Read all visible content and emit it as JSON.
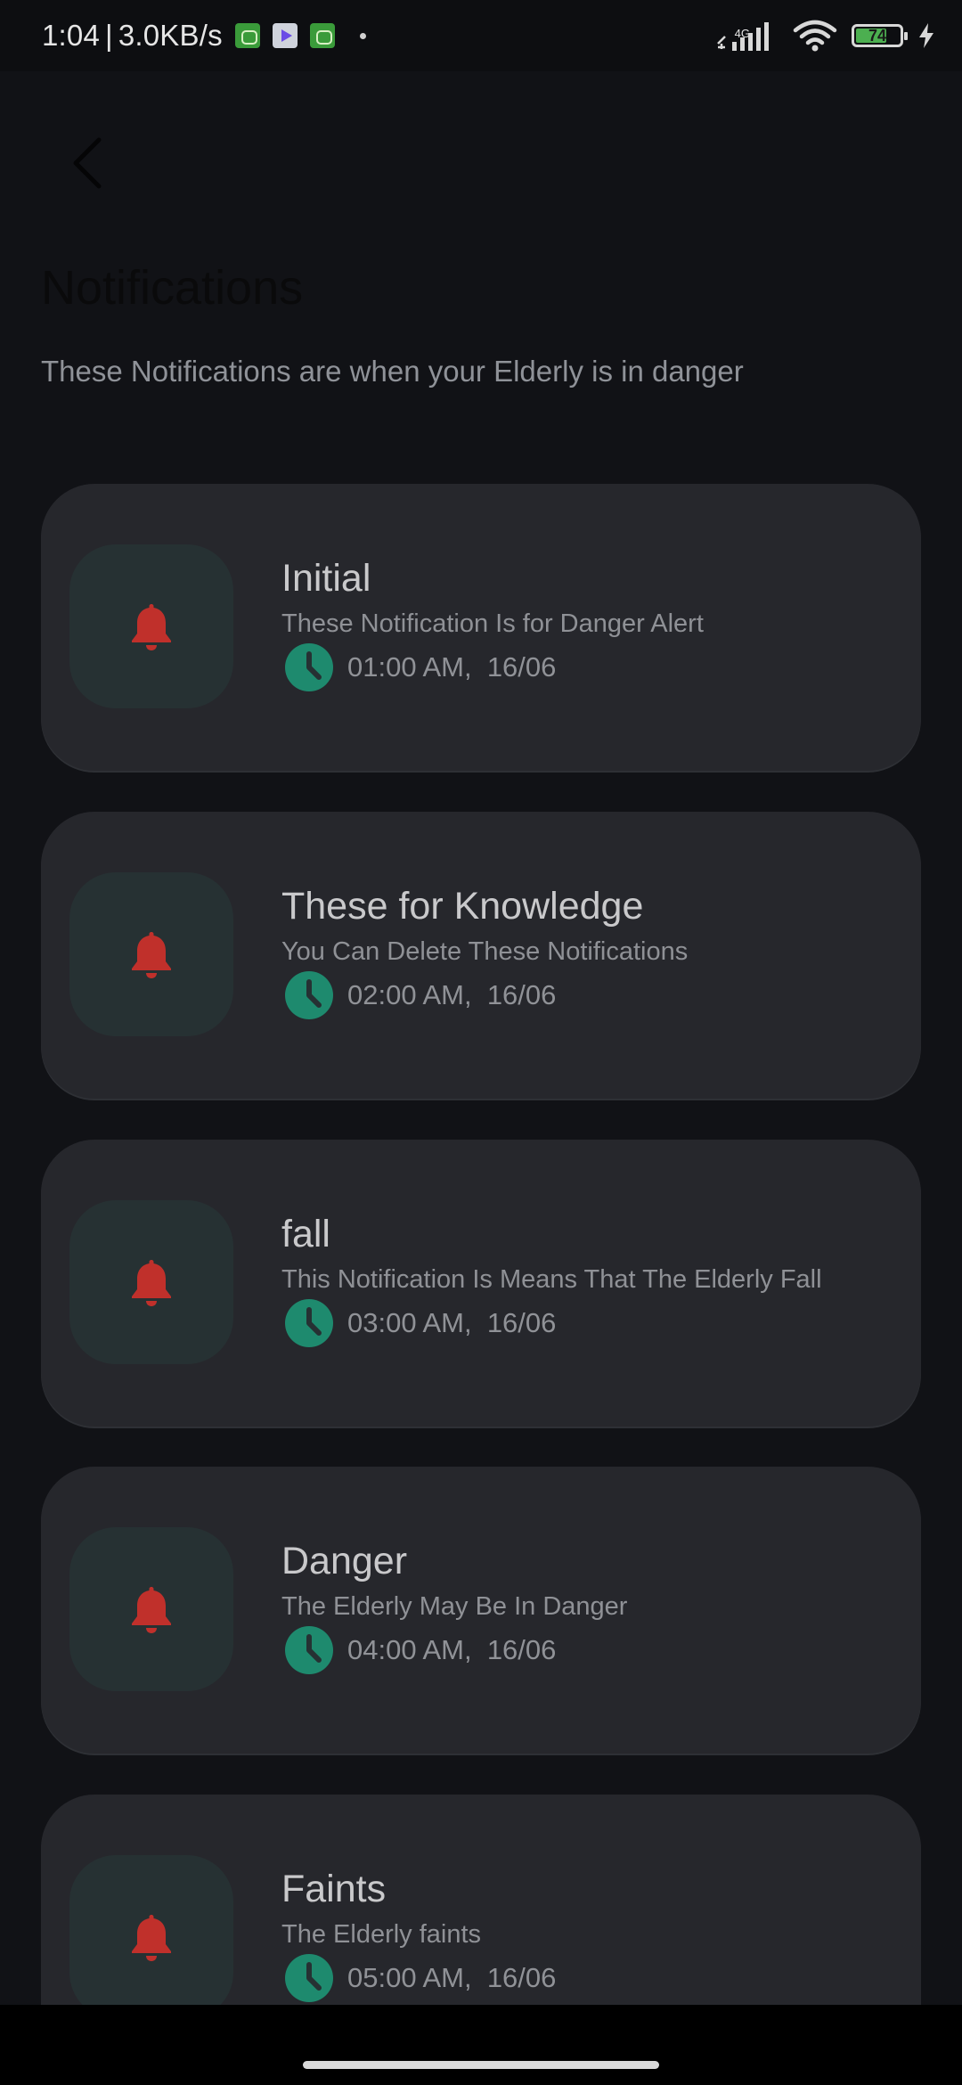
{
  "status_bar": {
    "time": "1:04",
    "separator": "|",
    "net_speed": "3.0KB/s",
    "network_type": "4G",
    "battery_level": "74",
    "battery_fraction": 0.74,
    "icons": [
      "app-notification-icon",
      "play-store-icon",
      "app-notification-icon",
      "dot-icon",
      "signal-icon",
      "wifi-icon",
      "battery-icon",
      "charging-icon"
    ]
  },
  "header": {
    "back_icon": "chevron-left-icon",
    "title": "Notifications",
    "subtitle": "These Notifications are when your Elderly is in danger"
  },
  "colors": {
    "background": "#111216",
    "card": "#26272c",
    "icon_box": "#263133",
    "bell": "#c0302b",
    "clock_circle": "#1e8a6e",
    "clock_hand": "#263133"
  },
  "notifications": [
    {
      "title": "Initial",
      "description": "These Notification Is for Danger Alert",
      "time": "01:00 AM,  16/06",
      "icon": "bell-icon"
    },
    {
      "title": "These for Knowledge",
      "description": "You Can Delete These Notifications",
      "time": "02:00 AM,  16/06",
      "icon": "bell-icon"
    },
    {
      "title": "fall",
      "description": "This Notification Is Means That The Elderly Fall",
      "time": "03:00 AM,  16/06",
      "icon": "bell-icon"
    },
    {
      "title": "Danger",
      "description": "The Elderly May Be In Danger",
      "time": "04:00 AM,  16/06",
      "icon": "bell-icon"
    },
    {
      "title": "Faints",
      "description": "The Elderly faints",
      "time": "05:00 AM,  16/06",
      "icon": "bell-icon"
    }
  ]
}
